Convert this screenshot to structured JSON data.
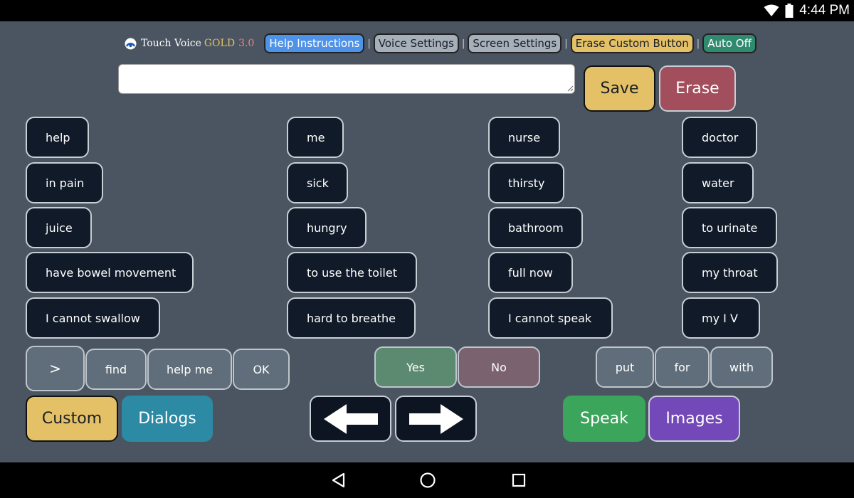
{
  "status": {
    "time": "4:44 PM",
    "wifi_icon": "wifi-icon",
    "battery_icon": "battery-icon"
  },
  "app": {
    "name": "Touch Voice",
    "edition": "GOLD",
    "version": "3.0"
  },
  "topbar": {
    "separator": "|",
    "buttons": [
      {
        "label": "Help Instructions",
        "bg": "#4f93e8",
        "fg": "#ffffff"
      },
      {
        "label": "Voice Settings",
        "bg": "#a6b0ba",
        "fg": "#1a1f26"
      },
      {
        "label": "Screen Settings",
        "bg": "#a6b0ba",
        "fg": "#1a1f26"
      },
      {
        "label": "Erase Custom Button",
        "bg": "#e4c066",
        "fg": "#1a1f26"
      },
      {
        "label": "Auto Off",
        "bg": "#2f8a6f",
        "fg": "#ffffff"
      }
    ]
  },
  "input": {
    "value": "",
    "placeholder": ""
  },
  "actions": {
    "save": "Save",
    "erase": "Erase"
  },
  "phrases": {
    "col1": [
      "help",
      "in pain",
      "juice",
      "have bowel movement",
      "I cannot swallow"
    ],
    "col2": [
      "me",
      "sick",
      "hungry",
      "to use the toilet",
      "hard to breathe"
    ],
    "col3": [
      "nurse",
      "thirsty",
      "bathroom",
      "full now",
      "I cannot speak"
    ],
    "col4": [
      "doctor",
      "water",
      "to urinate",
      "my throat",
      "my I V"
    ]
  },
  "words": {
    "left": [
      ">",
      "find",
      "help me",
      "OK"
    ],
    "yes": "Yes",
    "no": "No",
    "right": [
      "put",
      "for",
      "with"
    ]
  },
  "bottom": {
    "custom": "Custom",
    "dialogs": "Dialogs",
    "speak": "Speak",
    "images": "Images"
  },
  "colors": {
    "background": "#4b5561",
    "phrase_bg": "#111a28",
    "word_bg": "#5f6e7a",
    "save": "#e4c066",
    "erase": "#a34e5c",
    "yes": "#5b8a70",
    "no": "#7a636f",
    "custom": "#e4c066",
    "dialogs": "#2c8aa5",
    "speak": "#3ba55c",
    "images": "#7348b8",
    "arrow_bg": "#0d1422"
  },
  "nav": {
    "back_icon": "back-triangle-icon",
    "home_icon": "home-circle-icon",
    "recents_icon": "recents-square-icon"
  }
}
